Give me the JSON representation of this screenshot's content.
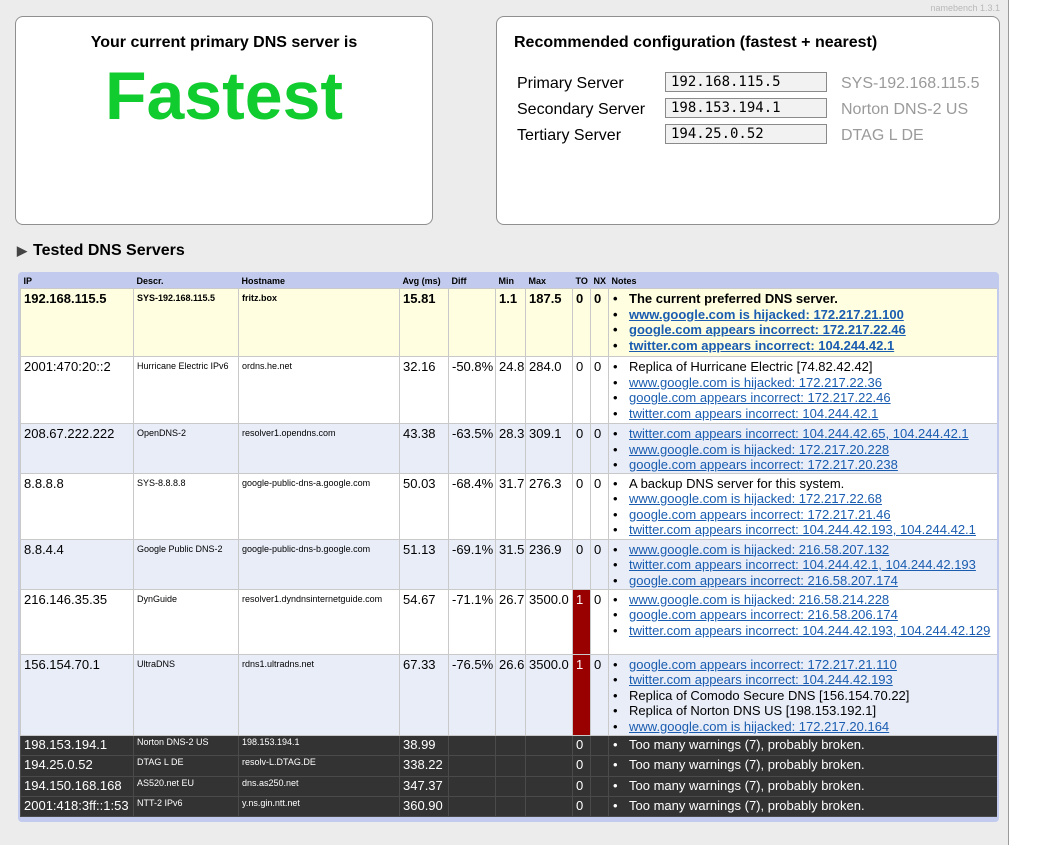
{
  "version": "namebench 1.3.1",
  "current": {
    "heading": "Your current primary DNS server is",
    "verdict": "Fastest"
  },
  "recommended": {
    "heading": "Recommended configuration (fastest + nearest)",
    "rows": [
      {
        "label": "Primary Server",
        "ip": "192.168.115.5",
        "name": "SYS-192.168.115.5"
      },
      {
        "label": "Secondary Server",
        "ip": "198.153.194.1",
        "name": "Norton DNS-2 US"
      },
      {
        "label": "Tertiary Server",
        "ip": "194.25.0.52",
        "name": "DTAG L DE"
      }
    ]
  },
  "tested": {
    "title": "Tested DNS Servers",
    "columns": [
      "IP",
      "Descr.",
      "Hostname",
      "Avg (ms)",
      "Diff",
      "Min",
      "Max",
      "TO",
      "NX",
      "Notes"
    ],
    "rows": [
      {
        "ip": "192.168.115.5",
        "descr": "SYS-192.168.115.5",
        "host": "fritz.box",
        "avg": "15.81",
        "diff": "",
        "min": "1.1",
        "max": "187.5",
        "to": "0",
        "nx": "0",
        "notes": [
          {
            "text": "The current preferred DNS server.",
            "link": false
          },
          {
            "text": "www.google.com is hijacked: 172.217.21.100",
            "link": true
          },
          {
            "text": "google.com appears incorrect: 172.217.22.46",
            "link": true
          },
          {
            "text": "twitter.com appears incorrect: 104.244.42.1",
            "link": true
          }
        ]
      },
      {
        "ip": "2001:470:20::2",
        "descr": "Hurricane Electric IPv6",
        "host": "ordns.he.net",
        "avg": "32.16",
        "diff": "-50.8%",
        "min": "24.8",
        "max": "284.0",
        "to": "0",
        "nx": "0",
        "notes": [
          {
            "text": "Replica of Hurricane Electric [74.82.42.42]",
            "link": false
          },
          {
            "text": "www.google.com is hijacked: 172.217.22.36",
            "link": true
          },
          {
            "text": "google.com appears incorrect: 172.217.22.46",
            "link": true
          },
          {
            "text": "twitter.com appears incorrect: 104.244.42.1",
            "link": true
          }
        ]
      },
      {
        "ip": "208.67.222.222",
        "descr": "OpenDNS-2",
        "host": "resolver1.opendns.com",
        "avg": "43.38",
        "diff": "-63.5%",
        "min": "28.3",
        "max": "309.1",
        "to": "0",
        "nx": "0",
        "notes": [
          {
            "text": "twitter.com appears incorrect: 104.244.42.65, 104.244.42.1",
            "link": true
          },
          {
            "text": "www.google.com is hijacked: 172.217.20.228",
            "link": true
          },
          {
            "text": "google.com appears incorrect: 172.217.20.238",
            "link": true
          }
        ]
      },
      {
        "ip": "8.8.8.8",
        "descr": "SYS-8.8.8.8",
        "host": "google-public-dns-a.google.com",
        "avg": "50.03",
        "diff": "-68.4%",
        "min": "31.7",
        "max": "276.3",
        "to": "0",
        "nx": "0",
        "notes": [
          {
            "text": "A backup DNS server for this system.",
            "link": false
          },
          {
            "text": "www.google.com is hijacked: 172.217.22.68",
            "link": true
          },
          {
            "text": "google.com appears incorrect: 172.217.21.46",
            "link": true
          },
          {
            "text": "twitter.com appears incorrect: 104.244.42.193, 104.244.42.1",
            "link": true
          }
        ]
      },
      {
        "ip": "8.8.4.4",
        "descr": "Google Public DNS-2",
        "host": "google-public-dns-b.google.com",
        "avg": "51.13",
        "diff": "-69.1%",
        "min": "31.5",
        "max": "236.9",
        "to": "0",
        "nx": "0",
        "notes": [
          {
            "text": "www.google.com is hijacked: 216.58.207.132",
            "link": true
          },
          {
            "text": "twitter.com appears incorrect: 104.244.42.1, 104.244.42.193",
            "link": true
          },
          {
            "text": "google.com appears incorrect: 216.58.207.174",
            "link": true
          }
        ]
      },
      {
        "ip": "216.146.35.35",
        "descr": "DynGuide",
        "host": "resolver1.dyndnsinternetguide.com",
        "avg": "54.67",
        "diff": "-71.1%",
        "min": "26.7",
        "max": "3500.0",
        "to": "1",
        "nx": "0",
        "notes": [
          {
            "text": "www.google.com is hijacked: 216.58.214.228",
            "link": true
          },
          {
            "text": "google.com appears incorrect: 216.58.206.174",
            "link": true
          },
          {
            "text": "twitter.com appears incorrect: 104.244.42.193, 104.244.42.129",
            "link": true
          }
        ]
      },
      {
        "ip": "156.154.70.1",
        "descr": "UltraDNS",
        "host": "rdns1.ultradns.net",
        "avg": "67.33",
        "diff": "-76.5%",
        "min": "26.6",
        "max": "3500.0",
        "to": "1",
        "nx": "0",
        "notes": [
          {
            "text": "google.com appears incorrect: 172.217.21.110",
            "link": true
          },
          {
            "text": "twitter.com appears incorrect: 104.244.42.193",
            "link": true
          },
          {
            "text": "Replica of Comodo Secure DNS [156.154.70.22]",
            "link": false
          },
          {
            "text": "Replica of Norton DNS US [198.153.192.1]",
            "link": false
          },
          {
            "text": "www.google.com is hijacked: 172.217.20.164",
            "link": true
          }
        ]
      },
      {
        "ip": "198.153.194.1",
        "descr": "Norton DNS-2 US",
        "host": "198.153.194.1",
        "avg": "38.99",
        "diff": "",
        "min": "",
        "max": "",
        "to": "0",
        "nx": "",
        "notes": [
          {
            "text": "Too many warnings (7), probably broken.",
            "link": false
          }
        ]
      },
      {
        "ip": "194.25.0.52",
        "descr": "DTAG L DE",
        "host": "resolv-L.DTAG.DE",
        "avg": "338.22",
        "diff": "",
        "min": "",
        "max": "",
        "to": "0",
        "nx": "",
        "notes": [
          {
            "text": "Too many warnings (7), probably broken.",
            "link": false
          }
        ]
      },
      {
        "ip": "194.150.168.168",
        "descr": "AS520.net EU",
        "host": "dns.as250.net",
        "avg": "347.37",
        "diff": "",
        "min": "",
        "max": "",
        "to": "0",
        "nx": "",
        "notes": [
          {
            "text": "Too many warnings (7), probably broken.",
            "link": false
          }
        ]
      },
      {
        "ip": "2001:418:3ff::1:53",
        "descr": "NTT-2 IPv6",
        "host": "y.ns.gin.ntt.net",
        "avg": "360.90",
        "diff": "",
        "min": "",
        "max": "",
        "to": "0",
        "nx": "",
        "notes": [
          {
            "text": "Too many warnings (7), probably broken.",
            "link": false
          }
        ]
      }
    ]
  }
}
